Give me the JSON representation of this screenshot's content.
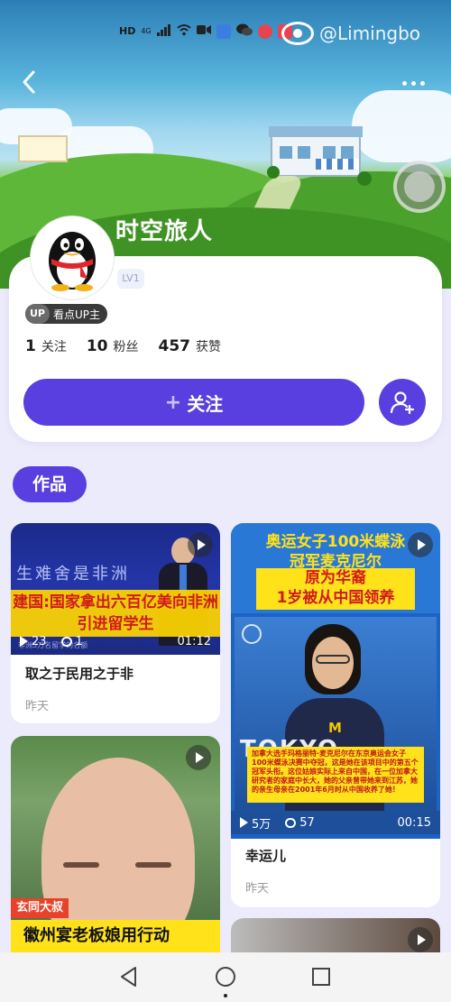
{
  "status_bar": {
    "network": "HD",
    "signal": "4G",
    "watermark": "@Limingbo"
  },
  "profile": {
    "username": "时空旅人",
    "level": "LV1",
    "up_tag": "UP",
    "up_badge": "看点UP主",
    "stats": [
      {
        "value": "1",
        "label": "关注"
      },
      {
        "value": "10",
        "label": "粉丝"
      },
      {
        "value": "457",
        "label": "获赞"
      }
    ],
    "follow_label": "关注",
    "follow_plus": "+"
  },
  "works_tab": "作品",
  "videos": [
    {
      "title": "取之于民用之于非",
      "time": "昨天",
      "plays": "23",
      "comments": "1",
      "duration": "01:12",
      "overlay_caption": "建国:国家拿出六百亿美向非洲引进留学生",
      "overlay_top": "生难舍是非洲",
      "overlay_small": "非洲5万名留学的名额"
    },
    {
      "title": "幸运儿",
      "time": "昨天",
      "plays": "5万",
      "comments": "57",
      "duration": "00:15",
      "overlay_head_1": "奥运女子100米蝶泳",
      "overlay_head_2": "冠军麦克尼尔",
      "overlay_head_3": "原为华裔",
      "overlay_head_4": "1岁被从中国领养",
      "overlay_brand": "TOKYO",
      "overlay_body": "加拿大选手玛格丽特·麦克尼尔在东京奥运会女子100米蝶泳决赛中夺冠，这是她在该项目中的第五个冠军头衔。这位姑娘实际上来自中国，在一位加拿大研究者的家庭中长大，她的父亲曾带她来到江苏，她的亲生母亲在2001年6月时从中国收养了她！"
    },
    {
      "overlay_tag": "玄同大叔",
      "overlay_caption": "徽州宴老板娘用行动"
    }
  ],
  "colors": {
    "accent": "#5a3fe0",
    "page_bg": "#ecebfb"
  }
}
